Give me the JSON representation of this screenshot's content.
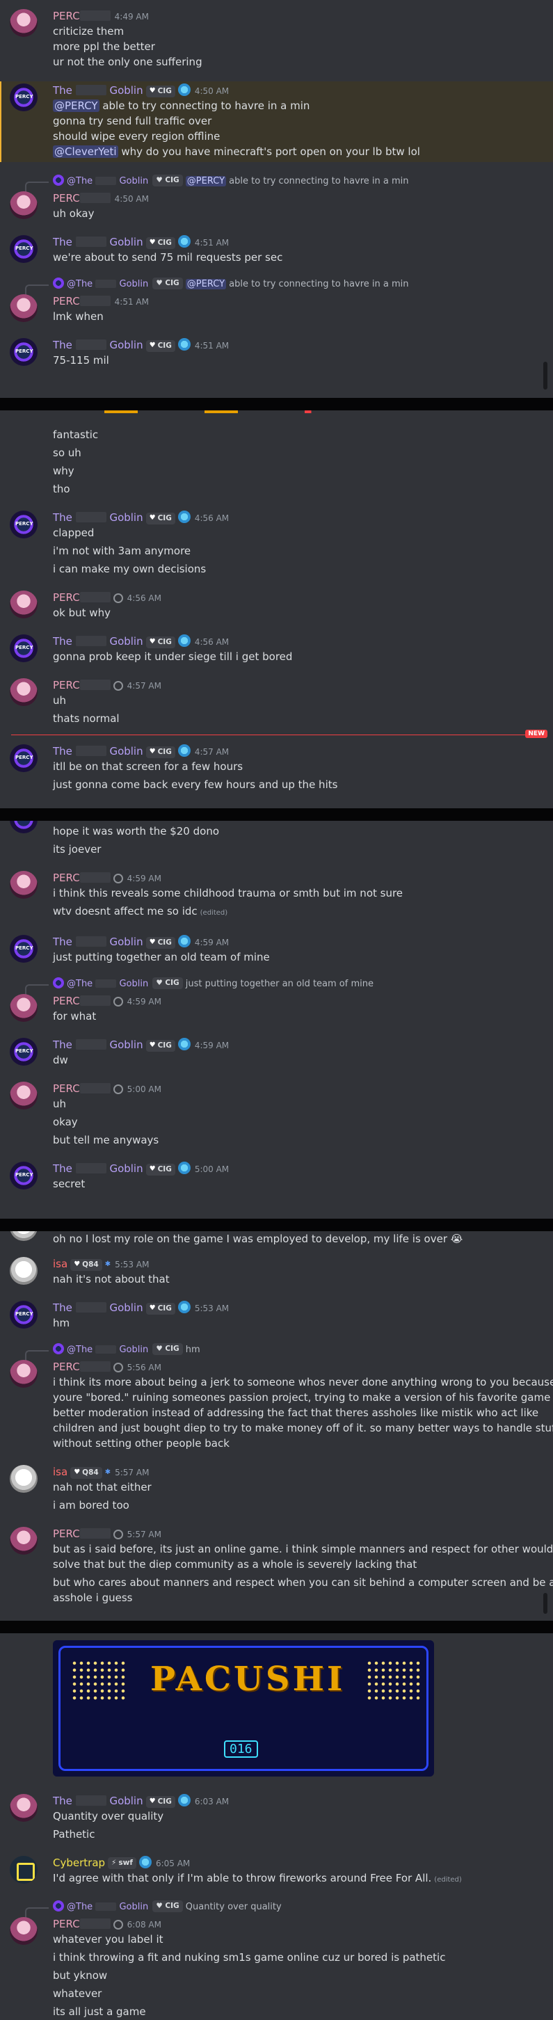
{
  "panels": [
    {
      "messages": [
        {
          "kind": "cont",
          "author": "PERCY",
          "time": "4:49 AM",
          "lines": [
            "criticize them",
            "more ppl the better",
            "ur not the only one suffering"
          ]
        },
        {
          "kind": "group",
          "author": "The Goblin",
          "tag": "CIG",
          "time": "4:50 AM",
          "lines": [
            "@PERCY able to try connecting to havre in a min",
            "gonna try send full traffic over",
            "should wipe every region offline",
            "@CleverYeti why do you have minecraft's port open on your lb btw lol"
          ]
        },
        {
          "kind": "group",
          "reply": "@The Goblin CIG @PERCY able to try connecting to havre in a min",
          "author": "PERCY",
          "time": "4:50 AM",
          "lines": [
            "uh okay"
          ]
        },
        {
          "kind": "group",
          "author": "The Goblin",
          "tag": "CIG",
          "time": "4:51 AM",
          "lines": [
            "we're about to send 75 mil requests per sec"
          ]
        },
        {
          "kind": "group",
          "reply": "@The Goblin CIG @PERCY able to try connecting to havre in a min",
          "author": "PERCY",
          "time": "4:51 AM",
          "lines": [
            "lmk when"
          ]
        },
        {
          "kind": "group",
          "author": "The Goblin",
          "tag": "CIG",
          "time": "4:51 AM",
          "lines": [
            "75-115 mil"
          ]
        }
      ]
    },
    {
      "messages": [
        {
          "kind": "cont",
          "lines": [
            "fantastic",
            "so uh",
            "why",
            "tho"
          ]
        },
        {
          "kind": "group",
          "author": "The Goblin",
          "tag": "CIG",
          "time": "4:56 AM",
          "lines": [
            "clapped",
            "i'm not with 3am anymore",
            "i can make my own decisions"
          ]
        },
        {
          "kind": "group",
          "author": "PERCY",
          "time": "4:56 AM",
          "lines": [
            "ok but why"
          ]
        },
        {
          "kind": "group",
          "author": "The Goblin",
          "tag": "CIG",
          "time": "4:56 AM",
          "lines": [
            "gonna prob keep it under siege till i get bored"
          ]
        },
        {
          "kind": "group",
          "author": "PERCY",
          "time": "4:57 AM",
          "lines": [
            "uh",
            "thats normal"
          ]
        },
        {
          "kind": "group",
          "author": "The Goblin",
          "tag": "CIG",
          "time": "4:57 AM",
          "new": "NEW",
          "lines": [
            "itll be on that screen for a few hours",
            "just gonna come back every few hours and up the hits"
          ]
        }
      ]
    },
    {
      "messages": [
        {
          "kind": "cont",
          "lines": [
            "hope it was worth the $20 dono",
            "its joever"
          ]
        },
        {
          "kind": "group",
          "author": "PERCY",
          "time": "4:59 AM",
          "lines": [
            "i think this reveals some childhood trauma or smth but im not sure",
            "wtv doesnt affect me so idc"
          ],
          "edited": "(edited)"
        },
        {
          "kind": "group",
          "author": "The Goblin",
          "tag": "CIG",
          "time": "4:59 AM",
          "lines": [
            "just putting together an old team of mine"
          ]
        },
        {
          "kind": "group",
          "reply": "@The Goblin CIG just putting together an old team of mine",
          "author": "PERCY",
          "time": "4:59 AM",
          "lines": [
            "for what"
          ]
        },
        {
          "kind": "group",
          "author": "The Goblin",
          "tag": "CIG",
          "time": "4:59 AM",
          "lines": [
            "dw"
          ]
        },
        {
          "kind": "group",
          "author": "PERCY",
          "time": "5:00 AM",
          "lines": [
            "uh",
            "okay",
            "but tell me anyways"
          ]
        },
        {
          "kind": "group",
          "author": "The Goblin",
          "tag": "CIG",
          "time": "5:00 AM",
          "lines": [
            "secret"
          ]
        }
      ]
    },
    {
      "messages": [
        {
          "kind": "cont",
          "lines": [
            "oh no I lost my role on the game I was employed to develop, my life is over 😭"
          ]
        },
        {
          "kind": "group",
          "author": "isa",
          "tag": "Q84",
          "time": "5:53 AM",
          "lines": [
            "nah it's not about that"
          ]
        },
        {
          "kind": "group",
          "author": "The Goblin",
          "tag": "CIG",
          "time": "5:53 AM",
          "lines": [
            "hm"
          ]
        },
        {
          "kind": "group",
          "reply": "@The Goblin CIG hm",
          "author": "PERCY",
          "time": "5:56 AM",
          "lines": [
            "i think its more about being a jerk to someone whos never done anything wrong to you because",
            "youre \"bored.\" ruining someones passion project, trying to make a version of his favorite game with",
            "better moderation instead of addressing the fact that theres assholes like mistik who act like",
            "children and just bought diep to try to make money off of it. so many better ways to handle stuff",
            "without setting other people back"
          ]
        },
        {
          "kind": "group",
          "author": "isa",
          "tag": "Q84",
          "time": "5:57 AM",
          "lines": [
            "nah not that either",
            "i am bored too"
          ]
        },
        {
          "kind": "group",
          "author": "PERCY",
          "time": "5:57 AM",
          "lines": [
            "but as i said before, its just an online game. i think simple manners and respect for other would",
            "solve that but the diep community as a whole is severely lacking that",
            "but who cares about manners and respect when you can sit behind a computer screen and be an",
            "asshole i guess"
          ]
        }
      ]
    },
    {
      "image": {
        "title": "PACUSHI",
        "score": "016"
      },
      "messages": [
        {
          "kind": "group",
          "author": "The Goblin",
          "tag": "CIG",
          "time": "6:03 AM",
          "lines": [
            "Quantity over quality",
            "Pathetic"
          ]
        },
        {
          "kind": "group",
          "author": "Cybertrap",
          "tag": "swf",
          "time": "6:05 AM",
          "lines": [
            "I'd agree with that only if I'm able to throw fireworks around Free For All."
          ],
          "edited": "(edited)"
        },
        {
          "kind": "group",
          "reply": "@The Goblin CIG Quantity over quality",
          "author": "PERCY",
          "time": "6:08 AM",
          "lines": [
            "whatever you label it",
            "i think throwing a fit and nuking sm1s game online cuz ur bored is pathetic",
            "but yknow",
            "whatever",
            "its all just a game"
          ]
        }
      ]
    }
  ]
}
